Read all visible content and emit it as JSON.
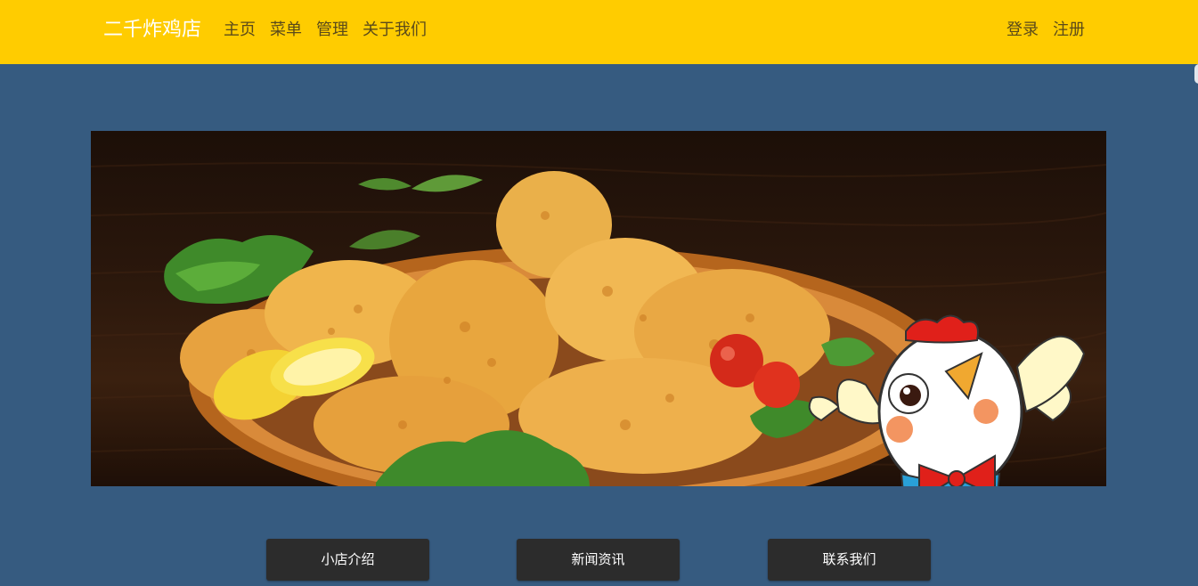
{
  "brand": "二千炸鸡店",
  "nav": {
    "home": "主页",
    "menu": "菜单",
    "manage": "管理",
    "about": "关于我们",
    "login": "登录",
    "register": "注册"
  },
  "banner": {
    "icon": "fried-chicken-banner-image"
  },
  "buttons": {
    "intro": "小店介绍",
    "news": "新闻资讯",
    "contact": "联系我们"
  },
  "colors": {
    "navbar": "#ffcc00",
    "background": "#365b80",
    "button": "#2c2c2c"
  }
}
